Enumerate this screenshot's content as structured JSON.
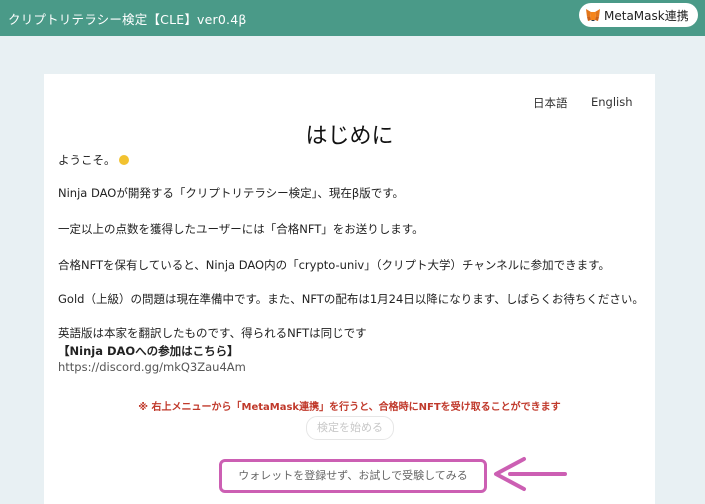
{
  "header": {
    "app_title": "クリプトリテラシー検定【CLE】ver0.4β",
    "metamask_button": "MetaMask連携"
  },
  "card": {
    "lang_ja": "日本語",
    "lang_en": "English",
    "title": "はじめに",
    "welcome": "ようこそ。",
    "paragraphs": [
      "Ninja DAOが開発する「クリプトリテラシー検定」、現在β版です。",
      "一定以上の点数を獲得したユーザーには「合格NFT」をお送りします。",
      "合格NFTを保有していると、Ninja DAO内の「crypto-univ」（クリプト大学）チャンネルに参加できます。",
      "Gold（上級）の問題は現在準備中です。また、NFTの配布は1月24日以降になります、しばらくお待ちください。",
      "英語版は本家を翻訳したものです、得られるNFTは同じです"
    ],
    "join_heading": "【Ninja DAOへの参加はこちら】",
    "discord_link": "https://discord.gg/mkQ3Zau4Am",
    "notice": "※ 右上メニューから「MetaMask連携」を行うと、合格時にNFTを受け取ることができます",
    "start_button": "検定を始める",
    "trial_button": "ウォレットを登録せず、お試しで受験してみる"
  },
  "colors": {
    "header_bg": "#4a9a88",
    "page_bg": "#e8f0f3",
    "notice_text": "#c0392b",
    "highlight": "#cc5fb3"
  }
}
